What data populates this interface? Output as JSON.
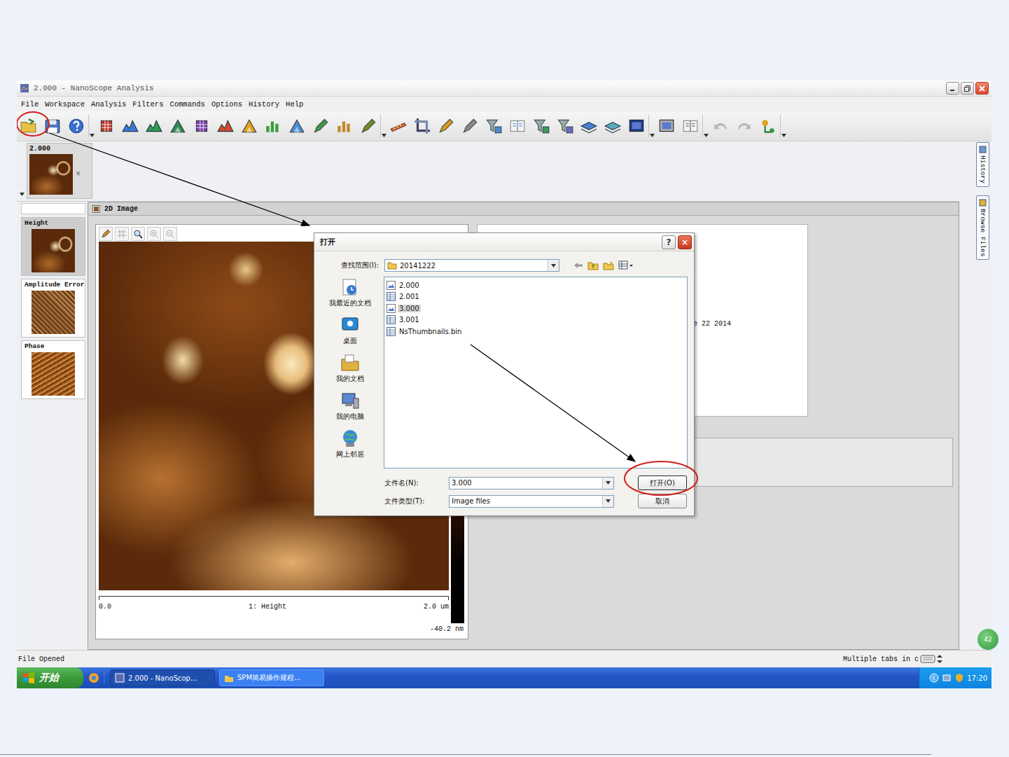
{
  "window": {
    "title": "2.000 - NanoScope Analysis"
  },
  "menu": [
    "File",
    "Workspace",
    "Analysis",
    "Filters",
    "Commands",
    "Options",
    "History",
    "Help"
  ],
  "open_file_tabs": [
    {
      "label": "2.000",
      "close": "×",
      "selected": true
    }
  ],
  "channels": [
    {
      "label": "Height",
      "selected": true
    },
    {
      "label": "Amplitude Error",
      "selected": false
    },
    {
      "label": "Phase",
      "selected": false
    }
  ],
  "panel": {
    "title": "2D Image"
  },
  "image": {
    "axis_start": "0.0",
    "channel": "1: Height",
    "axis_end": "2.0 um",
    "scale_min": "-40.2 nm"
  },
  "info": {
    "date_fragment": "e 22 2014"
  },
  "side_tabs": [
    "History",
    "Browse Files"
  ],
  "status_bar": {
    "left": "File Opened",
    "right": "Multiple tabs in c"
  },
  "taskbar": {
    "start": "开始",
    "tasks": [
      {
        "label": "2.000 - NanoScop...",
        "selected": true
      },
      {
        "label": "SPM简易操作规程...",
        "selected": false
      }
    ],
    "clock": "17:20"
  },
  "badge": "42",
  "dialog": {
    "title": "打开",
    "help": "?",
    "close": "×",
    "look_in_label": "查找范围(I):",
    "look_in": "20141222",
    "places": [
      "我最近的文档",
      "桌面",
      "我的文档",
      "我的电脑",
      "网上邻居"
    ],
    "files": [
      {
        "name": "2.000",
        "kind": "image",
        "selected": false
      },
      {
        "name": "2.001",
        "kind": "data",
        "selected": false
      },
      {
        "name": "3.000",
        "kind": "image",
        "selected": true
      },
      {
        "name": "3.001",
        "kind": "data",
        "selected": false
      },
      {
        "name": "NsThumbnails.bin",
        "kind": "data",
        "selected": false
      }
    ],
    "file_name_label": "文件名(N):",
    "file_name": "3.000",
    "file_type_label": "文件类型(T):",
    "file_type": "Image files",
    "open_button": "打开(O)",
    "cancel_button": "取消"
  },
  "annotations": {
    "circle_open_icon": true,
    "circle_open_button": true
  }
}
